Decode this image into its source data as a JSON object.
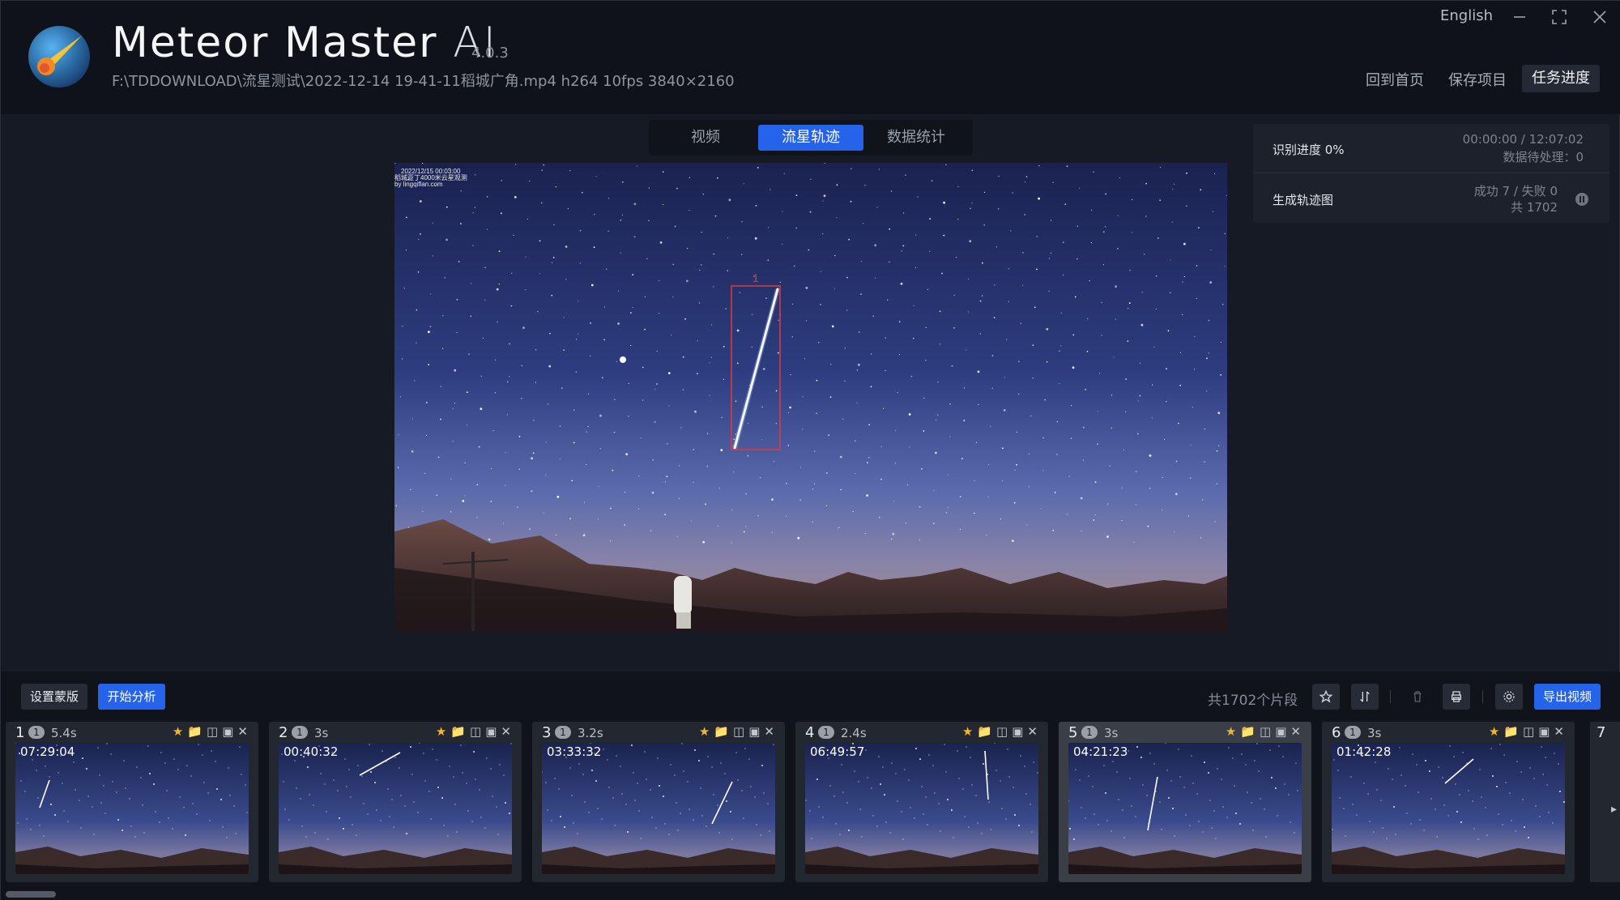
{
  "header": {
    "app_name": "Meteor Master",
    "app_suffix": "AI",
    "version": "4.0.3",
    "file_path": "F:\\TDDOWNLOAD\\流星测试\\2022-12-14 19-41-11稻城广角.mp4 h264 10fps 3840×2160",
    "language": "English",
    "links": {
      "home": "回到首页",
      "save": "保存项目",
      "task": "任务进度"
    }
  },
  "tabs": {
    "video": "视频",
    "track": "流星轨迹",
    "stats": "数据统计"
  },
  "main_image": {
    "overlay_line1": "2022/12/15 00:03:00",
    "overlay_line2": "稻城亚丁4000米云星观测",
    "overlay_line3": "by lingqiflan.com",
    "detection_label": "1"
  },
  "status": {
    "recognition_label": "识别进度 0%",
    "time_progress": "00:00:00 / 12:07:02",
    "pending": "数据待处理：0",
    "generate_label": "生成轨迹图",
    "success_fail": "成功 7 / 失败 0",
    "total": "共 1702"
  },
  "toolbar": {
    "mask_button": "设置蒙版",
    "analyze_button": "开始分析",
    "segment_count": "共1702个片段",
    "export_button": "导出视频"
  },
  "clips": [
    {
      "index": "1",
      "badge": "1",
      "duration": "5.4s",
      "time": "07:29:04",
      "selected": false
    },
    {
      "index": "2",
      "badge": "1",
      "duration": "3s",
      "time": "00:40:32",
      "selected": false
    },
    {
      "index": "3",
      "badge": "1",
      "duration": "3.2s",
      "time": "03:33:32",
      "selected": false
    },
    {
      "index": "4",
      "badge": "1",
      "duration": "2.4s",
      "time": "06:49:57",
      "selected": false
    },
    {
      "index": "5",
      "badge": "1",
      "duration": "3s",
      "time": "04:21:23",
      "selected": true
    },
    {
      "index": "6",
      "badge": "1",
      "duration": "3s",
      "time": "01:42:28",
      "selected": false
    }
  ],
  "partial_clip": {
    "index": "7"
  },
  "icons": {
    "logo": "meteor-logo-icon",
    "star": "star-icon",
    "folder": "folder-icon",
    "video": "video-icon",
    "camera": "camera-icon",
    "close": "close-icon"
  },
  "colors": {
    "accent": "#2563eb",
    "star": "#f2b630",
    "background": "#161a24",
    "detection_box": "#e03a3a"
  }
}
